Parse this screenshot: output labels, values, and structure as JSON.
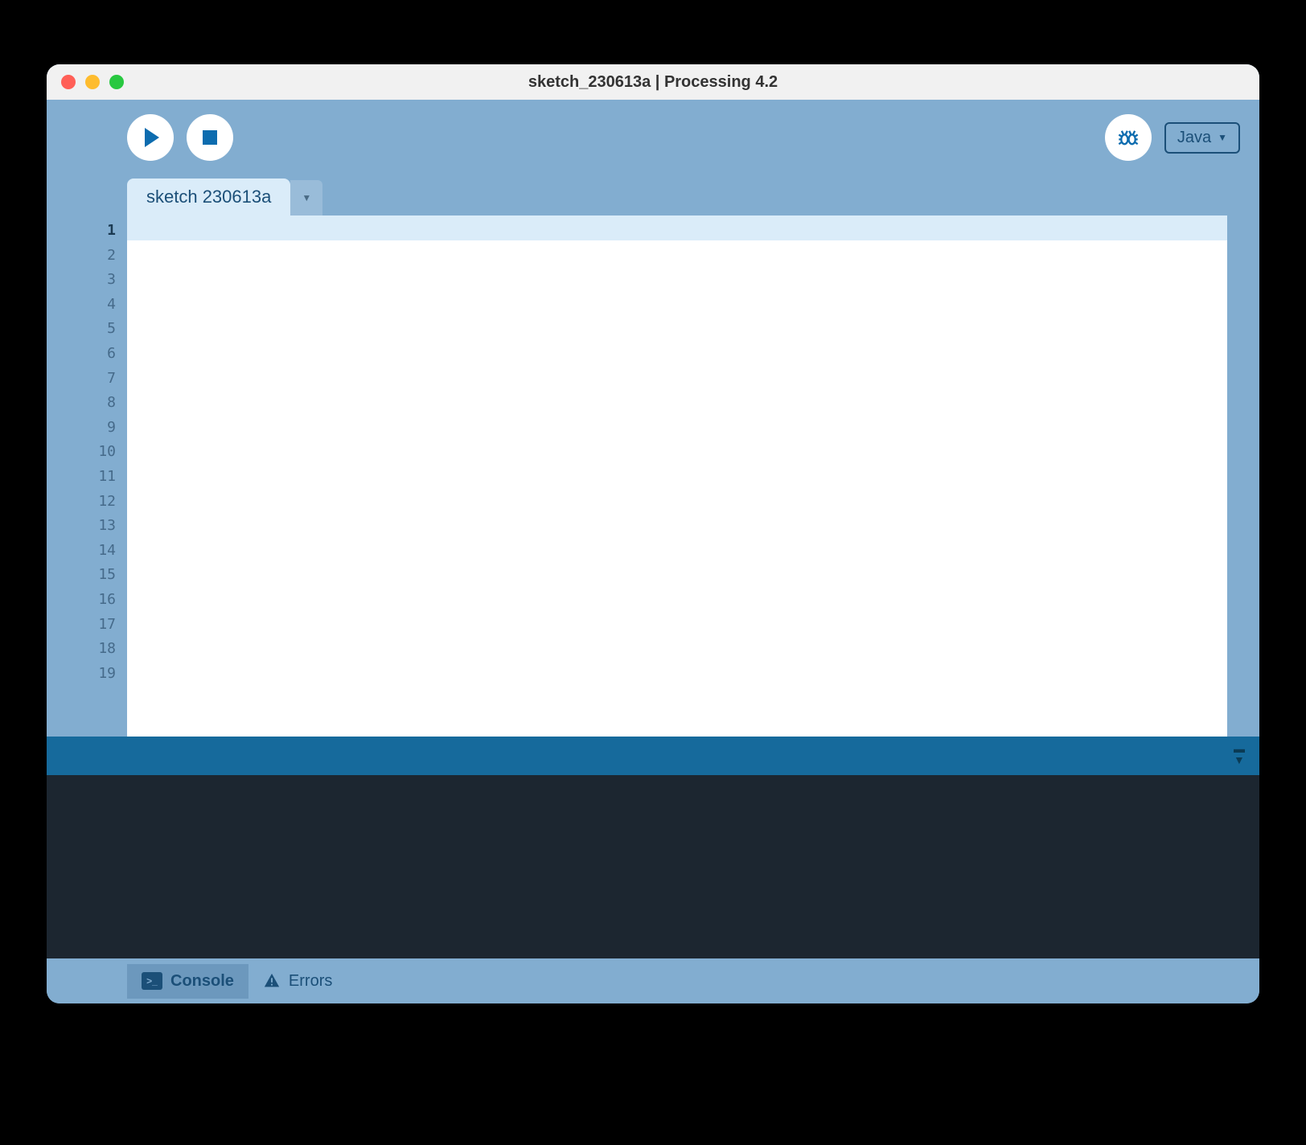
{
  "window": {
    "title": "sketch_230613a | Processing 4.2"
  },
  "toolbar": {
    "mode_label": "Java"
  },
  "tabs": {
    "active": "sketch 230613a"
  },
  "editor": {
    "line_numbers": [
      "1",
      "2",
      "3",
      "4",
      "5",
      "6",
      "7",
      "8",
      "9",
      "10",
      "11",
      "12",
      "13",
      "14",
      "15",
      "16",
      "17",
      "18",
      "19"
    ],
    "active_line": 1
  },
  "footer": {
    "console_label": "Console",
    "errors_label": "Errors"
  }
}
